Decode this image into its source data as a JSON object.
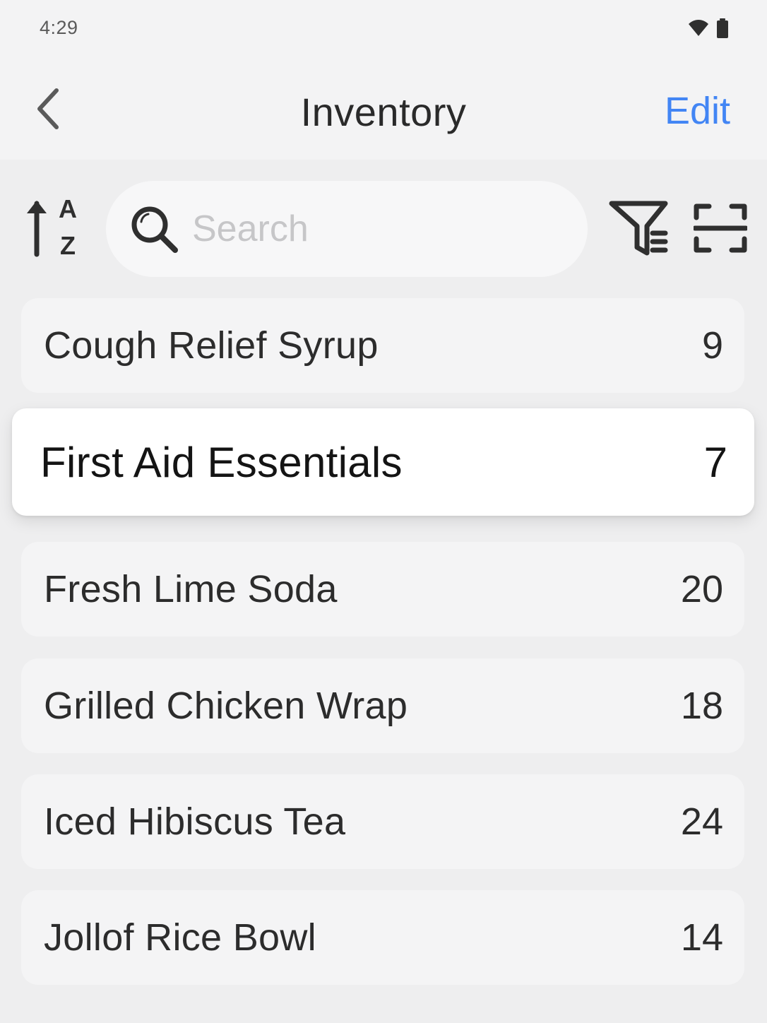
{
  "status_bar": {
    "time": "4:29",
    "icons": [
      "wifi-icon",
      "battery-icon"
    ]
  },
  "nav": {
    "back_icon": "chevron-left-icon",
    "title": "Inventory",
    "edit_label": "Edit"
  },
  "toolbar": {
    "sort_icon": "sort-alpha-ascending-icon",
    "search_icon": "search-icon",
    "search_placeholder": "Search",
    "search_value": "",
    "filter_icon": "filter-list-icon",
    "scan_icon": "barcode-scan-icon"
  },
  "items": [
    {
      "name": "Cough Relief Syrup",
      "count": "9",
      "selected": false
    },
    {
      "name": "First Aid Essentials",
      "count": "7",
      "selected": true
    },
    {
      "name": "Fresh Lime Soda",
      "count": "20",
      "selected": false
    },
    {
      "name": "Grilled Chicken Wrap",
      "count": "18",
      "selected": false
    },
    {
      "name": "Iced Hibiscus Tea",
      "count": "24",
      "selected": false
    },
    {
      "name": "Jollof Rice Bowl",
      "count": "14",
      "selected": false
    }
  ],
  "colors": {
    "accent": "#4285f4",
    "background": "#eeeeef",
    "card": "#f4f4f5",
    "selected_card": "#ffffff",
    "icon": "#2f2f2f"
  }
}
